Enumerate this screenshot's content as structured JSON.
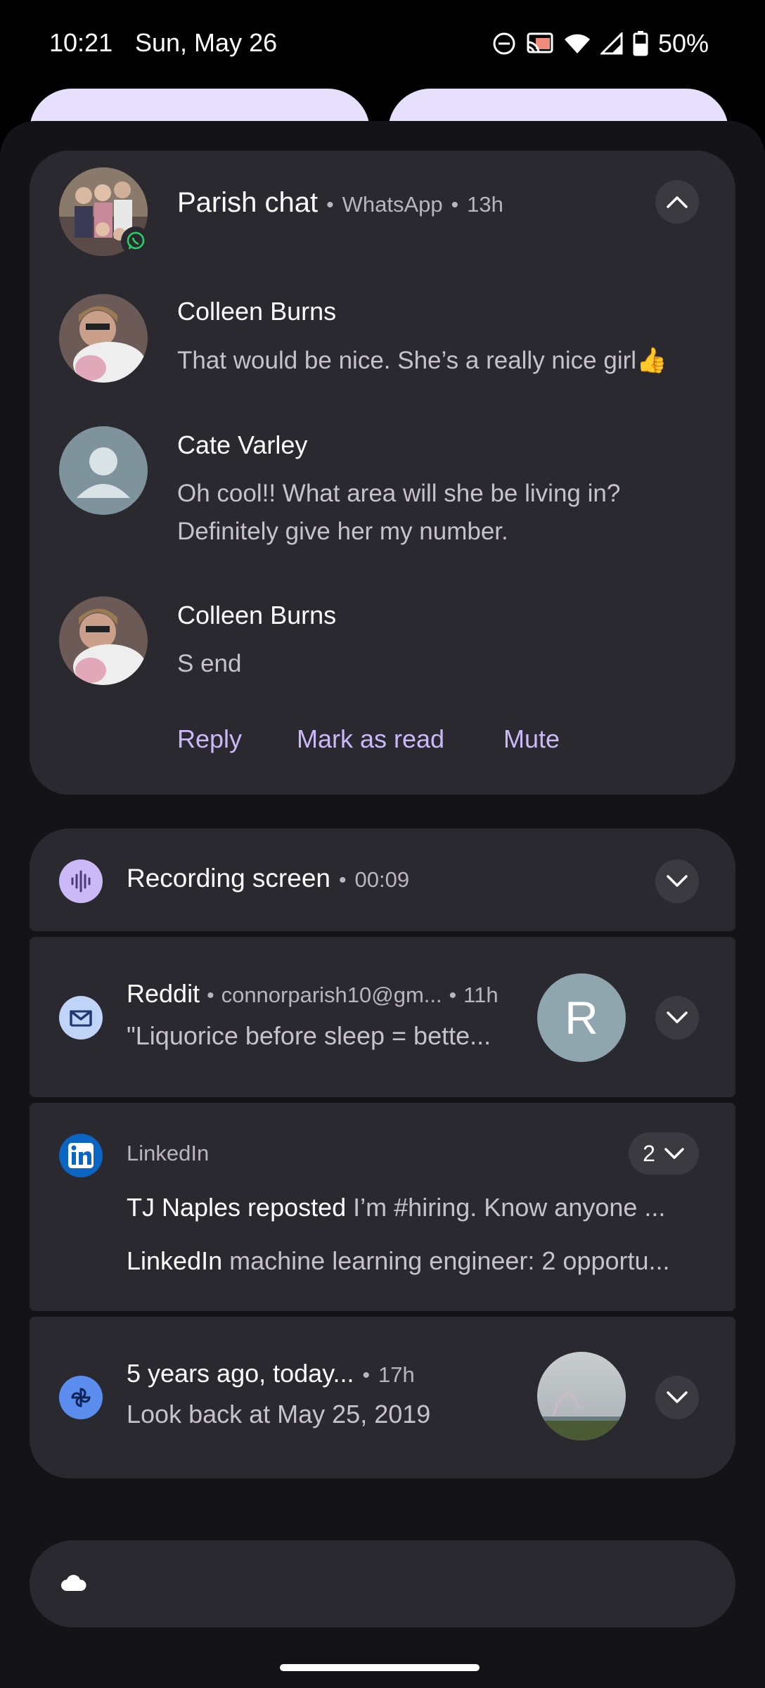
{
  "status_bar": {
    "time": "10:21",
    "date": "Sun, May 26",
    "battery": "50%",
    "icons": [
      "do-not-disturb-icon",
      "cast-icon",
      "wifi-icon",
      "signal-icon",
      "battery-icon"
    ]
  },
  "whatsapp_card": {
    "title": "Parish chat",
    "app": "WhatsApp",
    "time": "13h",
    "messages": [
      {
        "sender": "Colleen Burns",
        "text": "That would be nice. She’s a really nice girl👍"
      },
      {
        "sender": "Cate Varley",
        "text_line1": "Oh cool!! What area will she be living in?",
        "text_line2": "Definitely give her my number."
      },
      {
        "sender": "Colleen Burns",
        "text": "S end"
      }
    ],
    "actions": {
      "reply": "Reply",
      "mark_read": "Mark as read",
      "mute": "Mute"
    }
  },
  "recording_card": {
    "title": "Recording screen",
    "time": "00:09"
  },
  "reddit_card": {
    "title": "Reddit",
    "account": "connorparish10@gm...",
    "time": "11h",
    "text": "\"Liquorice before sleep = bette...",
    "avatar_letter": "R"
  },
  "linkedin_card": {
    "app": "LinkedIn",
    "count": "2",
    "line1_bold": "TJ Naples reposted",
    "line1_text": "I’m #hiring. Know anyone ...",
    "line2_bold": "LinkedIn",
    "line2_text": "machine learning engineer: 2 opportu..."
  },
  "photos_card": {
    "title": "5 years ago, today...",
    "time": "17h",
    "text": "Look back at May 25, 2019"
  },
  "colors": {
    "shade_bg": "#141317",
    "card_bg": "#2a2930",
    "accent": "#cbb8f7",
    "qs_tile": "#e6e0fc"
  }
}
